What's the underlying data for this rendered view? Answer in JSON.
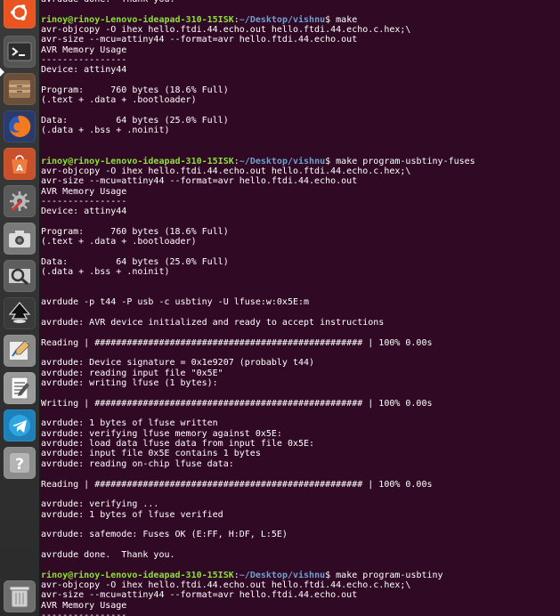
{
  "launcher": {
    "items": [
      {
        "name": "ubuntu-logo-icon",
        "color": "#e95420"
      },
      {
        "name": "terminal-icon",
        "color": "#2c2c2c"
      },
      {
        "name": "files-icon",
        "color": "#8a6d4e"
      },
      {
        "name": "firefox-icon",
        "color": "#e66000"
      },
      {
        "name": "software-center-icon",
        "color": "#e95420"
      },
      {
        "name": "settings-icon",
        "color": "#6b6b6b"
      },
      {
        "name": "screenshot-icon",
        "color": "#9a9a9a"
      },
      {
        "name": "image-viewer-icon",
        "color": "#7a7a7a"
      },
      {
        "name": "inkscape-icon",
        "color": "#222222"
      },
      {
        "name": "drawing-icon",
        "color": "#c9c9c9"
      },
      {
        "name": "text-editor-icon",
        "color": "#dcdcdc"
      },
      {
        "name": "telegram-icon",
        "color": "#2ca5e0"
      },
      {
        "name": "help-icon",
        "color": "#9e9e9e"
      },
      {
        "name": "trash-icon",
        "color": "#bdbdbd"
      }
    ],
    "help_glyph": "?"
  },
  "terminal": {
    "colors": {
      "background": "#300a24",
      "text": "#ffffff",
      "prompt": "#8ae234",
      "path": "#729fcf"
    },
    "lines": [
      {
        "text": "avrdude done.  Thank you."
      },
      {
        "text": ""
      },
      {
        "user": "rinoy@rinoy-Lenovo-ideapad-310-15ISK",
        "sep": ":",
        "path": "~/Desktop/vishnu",
        "text": "$ make"
      },
      {
        "text": "avr-objcopy -O ihex hello.ftdi.44.echo.out hello.ftdi.44.echo.c.hex;\\"
      },
      {
        "text": "avr-size --mcu=attiny44 --format=avr hello.ftdi.44.echo.out"
      },
      {
        "text": "AVR Memory Usage"
      },
      {
        "text": "----------------"
      },
      {
        "text": "Device: attiny44"
      },
      {
        "text": ""
      },
      {
        "text": "Program:     760 bytes (18.6% Full)"
      },
      {
        "text": "(.text + .data + .bootloader)"
      },
      {
        "text": ""
      },
      {
        "text": "Data:         64 bytes (25.0% Full)"
      },
      {
        "text": "(.data + .bss + .noinit)"
      },
      {
        "text": ""
      },
      {
        "text": ""
      },
      {
        "user": "rinoy@rinoy-Lenovo-ideapad-310-15ISK",
        "sep": ":",
        "path": "~/Desktop/vishnu",
        "text": "$ make program-usbtiny-fuses"
      },
      {
        "text": "avr-objcopy -O ihex hello.ftdi.44.echo.out hello.ftdi.44.echo.c.hex;\\"
      },
      {
        "text": "avr-size --mcu=attiny44 --format=avr hello.ftdi.44.echo.out"
      },
      {
        "text": "AVR Memory Usage"
      },
      {
        "text": "----------------"
      },
      {
        "text": "Device: attiny44"
      },
      {
        "text": ""
      },
      {
        "text": "Program:     760 bytes (18.6% Full)"
      },
      {
        "text": "(.text + .data + .bootloader)"
      },
      {
        "text": ""
      },
      {
        "text": "Data:         64 bytes (25.0% Full)"
      },
      {
        "text": "(.data + .bss + .noinit)"
      },
      {
        "text": ""
      },
      {
        "text": ""
      },
      {
        "text": "avrdude -p t44 -P usb -c usbtiny -U lfuse:w:0x5E:m"
      },
      {
        "text": ""
      },
      {
        "text": "avrdude: AVR device initialized and ready to accept instructions"
      },
      {
        "text": ""
      },
      {
        "text": "Reading | ################################################## | 100% 0.00s"
      },
      {
        "text": ""
      },
      {
        "text": "avrdude: Device signature = 0x1e9207 (probably t44)"
      },
      {
        "text": "avrdude: reading input file \"0x5E\""
      },
      {
        "text": "avrdude: writing lfuse (1 bytes):"
      },
      {
        "text": ""
      },
      {
        "text": "Writing | ################################################## | 100% 0.00s"
      },
      {
        "text": ""
      },
      {
        "text": "avrdude: 1 bytes of lfuse written"
      },
      {
        "text": "avrdude: verifying lfuse memory against 0x5E:"
      },
      {
        "text": "avrdude: load data lfuse data from input file 0x5E:"
      },
      {
        "text": "avrdude: input file 0x5E contains 1 bytes"
      },
      {
        "text": "avrdude: reading on-chip lfuse data:"
      },
      {
        "text": ""
      },
      {
        "text": "Reading | ################################################## | 100% 0.00s"
      },
      {
        "text": ""
      },
      {
        "text": "avrdude: verifying ..."
      },
      {
        "text": "avrdude: 1 bytes of lfuse verified"
      },
      {
        "text": ""
      },
      {
        "text": "avrdude: safemode: Fuses OK (E:FF, H:DF, L:5E)"
      },
      {
        "text": ""
      },
      {
        "text": "avrdude done.  Thank you."
      },
      {
        "text": ""
      },
      {
        "user": "rinoy@rinoy-Lenovo-ideapad-310-15ISK",
        "sep": ":",
        "path": "~/Desktop/vishnu",
        "text": "$ make program-usbtiny"
      },
      {
        "text": "avr-objcopy -O ihex hello.ftdi.44.echo.out hello.ftdi.44.echo.c.hex;\\"
      },
      {
        "text": "avr-size --mcu=attiny44 --format=avr hello.ftdi.44.echo.out"
      },
      {
        "text": "AVR Memory Usage"
      },
      {
        "text": "----------------"
      }
    ]
  }
}
